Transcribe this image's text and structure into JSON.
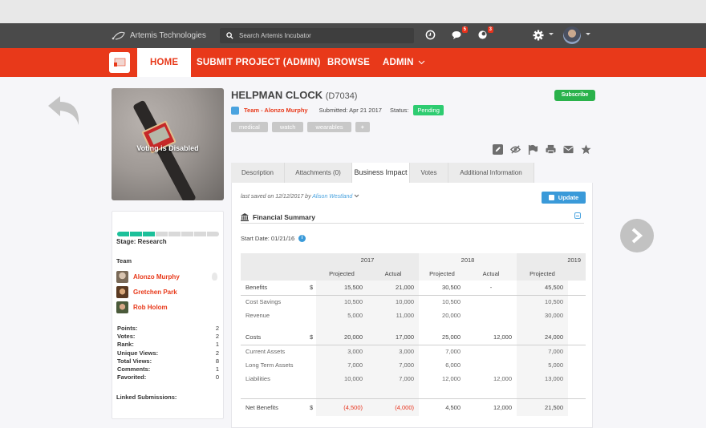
{
  "topbar": {
    "brand": "Artemis Technologies",
    "search_placeholder": "Search Artemis Incubator",
    "icons": [
      {
        "name": "clock-icon"
      },
      {
        "name": "chat-icon",
        "badge": "5"
      },
      {
        "name": "notification-icon",
        "badge": "3"
      },
      {
        "name": "gear-icon"
      }
    ]
  },
  "nav": {
    "items": [
      {
        "label": "HOME",
        "active": true
      },
      {
        "label": "SUBMIT PROJECT (ADMIN)"
      },
      {
        "label": "BROWSE"
      },
      {
        "label": "ADMIN",
        "dropdown": true
      }
    ]
  },
  "project": {
    "title": "HELPMAN CLOCK",
    "code": "(D7034)",
    "team_link": "Team - Alonzo Murphy",
    "submitted": "Submitted: Apr 21 2017",
    "status_label": "Status:",
    "status": "Pending",
    "subscribe": "Subscribe",
    "tags": [
      "medical",
      "watch",
      "wearables",
      "+"
    ],
    "voting_overlay": "Voting is Disabled",
    "actions": [
      "edit-icon",
      "hide-icon",
      "flag-icon",
      "print-icon",
      "email-icon",
      "star-icon"
    ]
  },
  "sidebar": {
    "stage_segments_total": 8,
    "stage_segments_complete": 3,
    "stage": "Stage: Research",
    "team_label": "Team",
    "team": [
      {
        "name": "Alonzo Murphy"
      },
      {
        "name": "Gretchen Park"
      },
      {
        "name": "Rob Holom"
      }
    ],
    "stats": [
      {
        "label": "Points:",
        "value": "2"
      },
      {
        "label": "Votes:",
        "value": "2"
      },
      {
        "label": "Rank:",
        "value": "1"
      },
      {
        "label": "Unique Views:",
        "value": "2"
      },
      {
        "label": "Total Views:",
        "value": "8"
      },
      {
        "label": "Comments:",
        "value": "1"
      },
      {
        "label": "Favorited:",
        "value": "0"
      }
    ],
    "linked": "Linked Submissions:"
  },
  "tabs": [
    {
      "label": "Description"
    },
    {
      "label": "Attachments (0)"
    },
    {
      "label": "Business Impact",
      "active": true
    },
    {
      "label": "Votes"
    },
    {
      "label": "Additional Information"
    }
  ],
  "panel": {
    "saved_prefix": "last saved on 12/12/2017 by",
    "saved_user": "Alison Westland",
    "update": "Update",
    "section_title": "Financial Summary",
    "start_date": "Start Date: 01/21/16"
  },
  "financial_table": {
    "years": [
      "2017",
      "2018",
      "2019"
    ],
    "subheaders": [
      "Projected",
      "Actual",
      "Projected",
      "Actual",
      "Projected"
    ],
    "rows": [
      {
        "label": "Benefits",
        "currency": "$",
        "values": [
          "15,500",
          "21,000",
          "30,500",
          "-",
          "45,500"
        ],
        "type": "main"
      },
      {
        "label": "Cost Savings",
        "currency": "",
        "values": [
          "10,500",
          "10,000",
          "10,500",
          "",
          "10,500"
        ],
        "type": "sub"
      },
      {
        "label": "Revenue",
        "currency": "",
        "values": [
          "5,000",
          "11,000",
          "20,000",
          "",
          "30,000"
        ],
        "type": "sub"
      },
      {
        "label": "Costs",
        "currency": "$",
        "values": [
          "20,000",
          "17,000",
          "25,000",
          "12,000",
          "24,000"
        ],
        "type": "main"
      },
      {
        "label": "Current Assets",
        "currency": "",
        "values": [
          "3,000",
          "3,000",
          "7,000",
          "",
          "7,000"
        ],
        "type": "sub"
      },
      {
        "label": "Long Term Assets",
        "currency": "",
        "values": [
          "7,000",
          "7,000",
          "6,000",
          "",
          "5,000"
        ],
        "type": "sub"
      },
      {
        "label": "Liabilities",
        "currency": "",
        "values": [
          "10,000",
          "7,000",
          "12,000",
          "12,000",
          "13,000"
        ],
        "type": "sub"
      },
      {
        "label": "Net Benefits",
        "currency": "$",
        "values": [
          "(4,500)",
          "(4,000)",
          "4,500",
          "12,000",
          "21,500"
        ],
        "type": "net"
      }
    ]
  },
  "colors": {
    "brand_red": "#e8391a",
    "topbar": "#4a4a4a",
    "subscribe_green": "#2ab24b",
    "pending_green": "#2ecc71",
    "stage_teal": "#1cc09a",
    "link_blue": "#4aa3df",
    "negative_red": "#e8321c"
  }
}
